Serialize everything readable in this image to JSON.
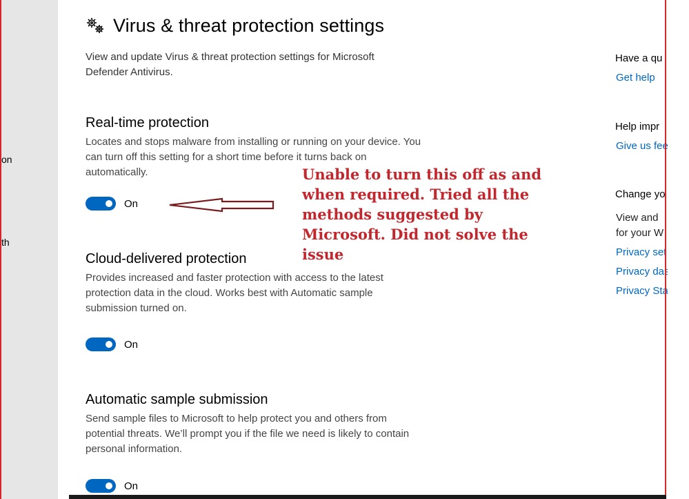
{
  "nav": {
    "fragment1": "on",
    "fragment2": "th"
  },
  "page": {
    "title": "Virus & threat protection settings",
    "intro": "View and update Virus & threat protection settings for Microsoft Defender Antivirus."
  },
  "sections": [
    {
      "title": "Real-time protection",
      "description": "Locates and stops malware from installing or running on your device. You can turn off this setting for a short time before it turns back on automatically.",
      "toggle_label": "On"
    },
    {
      "title": "Cloud-delivered protection",
      "description": "Provides increased and faster protection with access to the latest protection data in the cloud. Works best with Automatic sample submission turned on.",
      "toggle_label": "On"
    },
    {
      "title": "Automatic sample submission",
      "description": "Send sample files to Microsoft to help protect you and others from potential threats. We’ll prompt you if the file we need is likely to contain personal information.",
      "toggle_label": "On"
    }
  ],
  "right_column": {
    "question_heading": "Have a qu",
    "get_help_link": "Get help",
    "improve_heading": "Help impr",
    "give_feedback_link": "Give us fee",
    "privacy_heading": "Change yo",
    "privacy_text_1": "View and",
    "privacy_text_2": "for your W",
    "privacy_link_1": "Privacy set",
    "privacy_link_2": "Privacy das",
    "privacy_link_3": "Privacy Sta"
  },
  "annotation": {
    "text": "Unable to turn this off as and when required. Tried all the methods suggested by Microsoft. Did not solve the issue",
    "color": "#c1272d"
  },
  "colors": {
    "accent": "#0067c0",
    "border": "#d9252a"
  },
  "icons": {
    "title_icon": "gears-icon",
    "arrow": "left-arrow-icon"
  }
}
